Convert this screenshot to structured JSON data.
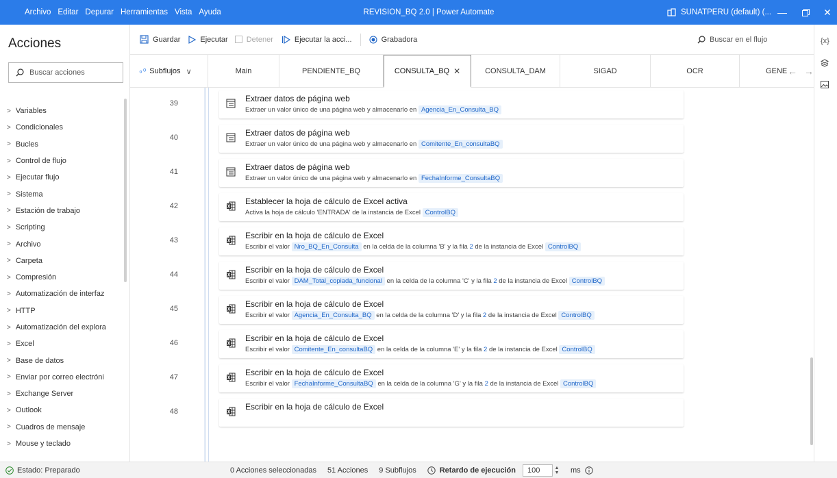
{
  "titlebar": {
    "menu": [
      "Archivo",
      "Editar",
      "Depurar",
      "Herramientas",
      "Vista",
      "Ayuda"
    ],
    "window_title": "REVISION_BQ 2.0 | Power Automate",
    "account": "SUNATPERU (default) (...",
    "color": "#2b7ce9"
  },
  "left_panel": {
    "title": "Acciones",
    "search_placeholder": "Buscar acciones",
    "categories": [
      "Variables",
      "Condicionales",
      "Bucles",
      "Control de flujo",
      "Ejecutar flujo",
      "Sistema",
      "Estación de trabajo",
      "Scripting",
      "Archivo",
      "Carpeta",
      "Compresión",
      "Automatización de interfaz",
      "HTTP",
      "Automatización del explora",
      "Excel",
      "Base de datos",
      "Enviar por correo electróni",
      "Exchange Server",
      "Outlook",
      "Cuadros de mensaje",
      "Mouse y teclado"
    ]
  },
  "toolbar": {
    "save": "Guardar",
    "run": "Ejecutar",
    "stop": "Detener",
    "run_action": "Ejecutar la acci...",
    "recorder": "Grabadora",
    "search_flow": "Buscar en el flujo"
  },
  "tabs": {
    "subflows": "Subflujos",
    "items": [
      "Main",
      "PENDIENTE_BQ",
      "CONSULTA_BQ",
      "CONSULTA_DAM",
      "SIGAD",
      "OCR",
      "GENE"
    ],
    "active": "CONSULTA_BQ"
  },
  "rail": {
    "variables_icon_label": "{x}"
  },
  "flow_rows": [
    {
      "num": "39",
      "title": "Extraer datos de página web",
      "parts": [
        "Extraer un valor único de una página web y almacenarlo en "
      ],
      "chip": "Agencia_En_Consulta_BQ",
      "icon": "web"
    },
    {
      "num": "40",
      "title": "Extraer datos de página web",
      "parts": [
        "Extraer un valor único de una página web y almacenarlo en "
      ],
      "chip": "Comitente_En_consultaBQ",
      "icon": "web"
    },
    {
      "num": "41",
      "title": "Extraer datos de página web",
      "parts": [
        "Extraer un valor único de una página web y almacenarlo en "
      ],
      "chip": "FechaInforme_ConsultaBQ",
      "icon": "web"
    },
    {
      "num": "42",
      "title": "Establecer la hoja de cálculo de Excel activa",
      "desc_pre": "Activa la hoja de cálculo 'ENTRADA' de la instancia de Excel ",
      "chip2": "ControlBQ",
      "icon": "excel"
    },
    {
      "num": "43",
      "title": "Escribir en la hoja de cálculo de Excel",
      "value": "Nro_BQ_En_Consulta",
      "col": "B",
      "row": "2",
      "instance": "ControlBQ",
      "icon": "excel"
    },
    {
      "num": "44",
      "title": "Escribir en la hoja de cálculo de Excel",
      "value": "DAM_Total_copiada_funcional",
      "col": "C",
      "row": "2",
      "instance": "ControlBQ",
      "icon": "excel"
    },
    {
      "num": "45",
      "title": "Escribir en la hoja de cálculo de Excel",
      "value": "Agencia_En_Consulta_BQ",
      "col": "D",
      "row": "2",
      "instance": "ControlBQ",
      "icon": "excel"
    },
    {
      "num": "46",
      "title": "Escribir en la hoja de cálculo de Excel",
      "value": "Comitente_En_consultaBQ",
      "col": "E",
      "row": "2",
      "instance": "ControlBQ",
      "icon": "excel"
    },
    {
      "num": "47",
      "title": "Escribir en la hoja de cálculo de Excel",
      "value": "FechaInforme_ConsultaBQ",
      "col": "G",
      "row": "2",
      "instance": "ControlBQ",
      "icon": "excel"
    },
    {
      "num": "48",
      "title": "Escribir en la hoja de cálculo de Excel",
      "value": "",
      "icon": "excel"
    }
  ],
  "write_text": {
    "prefix": "Escribir el valor ",
    "mid": " en la celda de la columna '",
    "mid2": "' y la fila ",
    "mid3": " de la instancia de Excel "
  },
  "status": {
    "state": "Estado: Preparado",
    "selected": "0 Acciones seleccionadas",
    "actions": "51 Acciones",
    "subflows": "9 Subflujos",
    "delay_label": "Retardo de ejecución",
    "delay_value": "100",
    "unit": "ms"
  }
}
